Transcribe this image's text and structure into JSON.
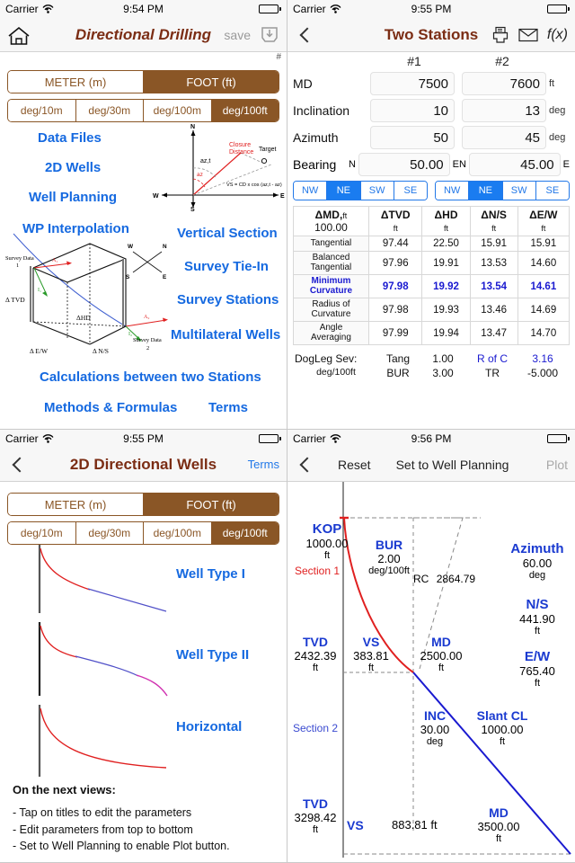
{
  "panes": {
    "home": {
      "status": {
        "carrier": "Carrier",
        "time": "9:54 PM"
      },
      "nav": {
        "home_icon": "home-icon",
        "title": "Directional Drilling",
        "save_label": "save",
        "save_icon": "save-tray-icon"
      },
      "hash": "#",
      "units": {
        "length": [
          "METER (m)",
          "FOOT (ft)"
        ],
        "length_selected": "FOOT (ft)",
        "gradient": [
          "deg/10m",
          "deg/30m",
          "deg/100m",
          "deg/100ft"
        ],
        "gradient_selected": "deg/100ft"
      },
      "links": [
        {
          "label": "Data Files"
        },
        {
          "label": "2D Wells"
        },
        {
          "label": "Well Planning"
        },
        {
          "label": "WP Interpolation"
        },
        {
          "label": "Vertical Section"
        },
        {
          "label": "Survey Tie-In"
        },
        {
          "label": "Survey Stations"
        },
        {
          "label": "Multilateral Wells"
        },
        {
          "label": "Calculations between two Stations"
        },
        {
          "label": "Methods & Formulas"
        },
        {
          "label": "Terms"
        }
      ],
      "vs_diagram": {
        "n": "N",
        "s": "S",
        "e": "E",
        "w": "W",
        "closure": "Closure",
        "closure2": "Distance",
        "azt": "az,t",
        "az": "az",
        "target": "Target",
        "formula": "VS = CD x cos (az,t - az)"
      },
      "cube_diagram": {
        "survey1": "Survey Data",
        "survey1n": "1",
        "survey2": "Survey Data",
        "survey2n": "2",
        "a1": "A₁",
        "a2": "A₂",
        "i1": "I₁",
        "i2": "I₂",
        "tvd": "Δ TVD",
        "hd": "ΔHD",
        "ew": "Δ E/W",
        "ns": "Δ N/S",
        "n": "N",
        "s": "S",
        "e": "E",
        "w": "W"
      }
    },
    "two_stations": {
      "status": {
        "carrier": "Carrier",
        "time": "9:55 PM"
      },
      "nav": {
        "back_icon": "chevron-left-icon",
        "title": "Two Stations",
        "print_icon": "printer-icon",
        "mail_icon": "envelope-icon",
        "fx_label": "f(x)"
      },
      "hash": "#",
      "columns": [
        "#1",
        "#2"
      ],
      "fields": [
        {
          "label": "MD",
          "v1": "7500",
          "v2": "7600",
          "unit": "ft"
        },
        {
          "label": "Inclination",
          "v1": "10",
          "v2": "13",
          "unit": "deg"
        },
        {
          "label": "Azimuth",
          "v1": "50",
          "v2": "45",
          "unit": "deg"
        }
      ],
      "bearing": {
        "label": "Bearing",
        "pre1": "N",
        "v1": "50.00",
        "post1": "E",
        "pre2": "N",
        "v2": "45.00",
        "post2": "E"
      },
      "quadrants": [
        "NW",
        "NE",
        "SW",
        "SE"
      ],
      "quadrant_selected_1": "NE",
      "quadrant_selected_2": "NE",
      "table": {
        "headers": [
          "ΔMD,",
          "ΔTVD",
          "ΔHD",
          "ΔN/S",
          "ΔE/W"
        ],
        "header_units": [
          "ft",
          "ft",
          "ft",
          "ft",
          "ft"
        ],
        "md_value": "100.00",
        "rows": [
          {
            "name": "Tangential",
            "values": [
              "97.44",
              "22.50",
              "15.91",
              "15.91"
            ],
            "highlight": false
          },
          {
            "name": "Balanced\nTangential",
            "values": [
              "97.96",
              "19.91",
              "13.53",
              "14.60"
            ],
            "highlight": false
          },
          {
            "name": "Minimum\nCurvature",
            "values": [
              "97.98",
              "19.92",
              "13.54",
              "14.61"
            ],
            "highlight": true
          },
          {
            "name": "Radius of\nCurvature",
            "values": [
              "97.98",
              "19.93",
              "13.46",
              "14.69"
            ],
            "highlight": false
          },
          {
            "name": "Angle\nAveraging",
            "values": [
              "97.99",
              "19.94",
              "13.47",
              "14.70"
            ],
            "highlight": false
          }
        ]
      },
      "dogleg": {
        "label": "DogLeg Sev:",
        "unit": "deg/100ft",
        "tang_label": "Tang",
        "tang_value": "1.00",
        "bur_label": "BUR",
        "bur_value": "3.00",
        "rofc_label": "R of C",
        "rofc_value": "3.16",
        "tr_label": "TR",
        "tr_value": "-5.000"
      }
    },
    "wells2d": {
      "status": {
        "carrier": "Carrier",
        "time": "9:55 PM"
      },
      "nav": {
        "back_icon": "chevron-left-icon",
        "title": "2D Directional Wells",
        "terms_label": "Terms"
      },
      "units": {
        "length": [
          "METER (m)",
          "FOOT (ft)"
        ],
        "length_selected": "FOOT (ft)",
        "gradient": [
          "deg/10m",
          "deg/30m",
          "deg/100m",
          "deg/100ft"
        ],
        "gradient_selected": "deg/100ft"
      },
      "well_types": [
        {
          "label": "Well Type I"
        },
        {
          "label": "Well Type II"
        },
        {
          "label": "Horizontal"
        }
      ],
      "notes": {
        "title": "On the next views:",
        "lines": [
          "- Tap on titles to edit  the parameters",
          "- Edit parameters from top to bottom",
          "- Set to Well Planning to enable Plot button."
        ]
      }
    },
    "plot": {
      "status": {
        "carrier": "Carrier",
        "time": "9:56 PM"
      },
      "nav": {
        "back_icon": "chevron-left-icon",
        "reset_label": "Reset",
        "set_label": "Set to Well Planning",
        "plot_label": "Plot"
      },
      "labels": {
        "kop": "KOP",
        "kop_value": "1000.00",
        "kop_unit": "ft",
        "bur": "BUR",
        "bur_value": "2.00",
        "bur_unit": "deg/100ft",
        "rc": "RC",
        "rc_value": "2864.79",
        "section1": "Section 1",
        "section2": "Section 2",
        "tvd1": "TVD",
        "tvd1_value": "2432.39",
        "tvd1_unit": "ft",
        "vs1": "VS",
        "vs1_value": "383.81",
        "vs1_unit": "ft",
        "md1": "MD",
        "md1_value": "2500.00",
        "md1_unit": "ft",
        "inc": "INC",
        "inc_value": "30.00",
        "inc_unit": "deg",
        "slant": "Slant CL",
        "slant_value": "1000.00",
        "slant_unit": "ft",
        "tvd2": "TVD",
        "tvd2_value": "3298.42",
        "tvd2_unit": "ft",
        "vs2": "VS",
        "vs2_value": "883.81 ft",
        "md2": "MD",
        "md2_value": "3500.00",
        "md2_unit": "ft",
        "azimuth": "Azimuth",
        "azimuth_value": "60.00",
        "azimuth_unit": "deg",
        "ns": "N/S",
        "ns_value": "441.90",
        "ns_unit": "ft",
        "ew": "E/W",
        "ew_value": "765.40",
        "ew_unit": "ft"
      }
    }
  },
  "colors": {
    "brand": "#7b2d14",
    "selector": "#8a5626",
    "link": "#1569e0",
    "accent_blue": "#1a1ad0",
    "ios_blue": "#2278e8",
    "red": "#e02020"
  }
}
